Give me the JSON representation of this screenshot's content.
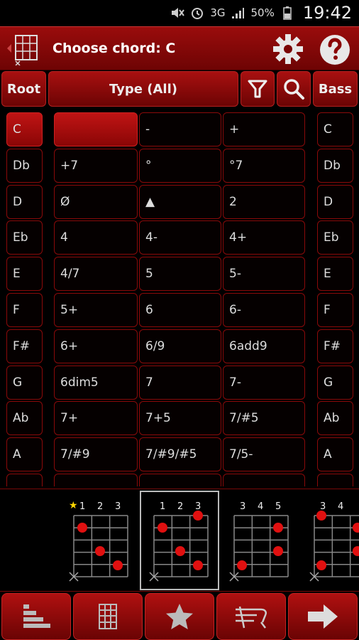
{
  "status_bar": {
    "network": "3G",
    "battery": "50%",
    "time": "19:42",
    "icons": [
      "mute-icon",
      "alarm-icon",
      "signal-icon",
      "battery-icon"
    ]
  },
  "header": {
    "title": "Choose chord: C",
    "icons": [
      "chord-diagram-icon",
      "gear-icon",
      "help-icon"
    ]
  },
  "toolbar": {
    "root_label": "Root",
    "type_label": "Type (All)",
    "bass_label": "Bass",
    "icons": [
      "filter-icon",
      "search-icon"
    ]
  },
  "roots": [
    "C",
    "Db",
    "D",
    "Eb",
    "E",
    "F",
    "F#",
    "G",
    "Ab",
    "A"
  ],
  "types": [
    [
      "",
      "-",
      "+"
    ],
    [
      "+7",
      "°",
      "°7"
    ],
    [
      "Ø",
      "▲",
      "2"
    ],
    [
      "4",
      "4-",
      "4+"
    ],
    [
      "4/7",
      "5",
      "5-"
    ],
    [
      "5+",
      "6",
      "6-"
    ],
    [
      "6+",
      "6/9",
      "6add9"
    ],
    [
      "6dim5",
      "7",
      "7-"
    ],
    [
      "7+",
      "7+5",
      "7/#5"
    ],
    [
      "7/#9",
      "7/#9/#5",
      "7/5-"
    ]
  ],
  "basses": [
    "C",
    "Db",
    "D",
    "Eb",
    "E",
    "F",
    "F#",
    "G",
    "Ab",
    "A"
  ],
  "diagrams": [
    {
      "frets": [
        "1",
        "2",
        "3"
      ],
      "favorite": true
    },
    {
      "frets": [
        "1",
        "2",
        "3"
      ],
      "favorite": false
    },
    {
      "frets": [
        "3",
        "4",
        "5"
      ],
      "favorite": false
    },
    {
      "frets": [
        "3",
        "4"
      ],
      "favorite": false
    }
  ],
  "bottom_nav": [
    "sort-icon",
    "keypad-icon",
    "star-icon",
    "fretboard-icon",
    "arrow-right-icon"
  ],
  "colors": {
    "accent": "#9a0c0c",
    "dot": "#e01010"
  }
}
